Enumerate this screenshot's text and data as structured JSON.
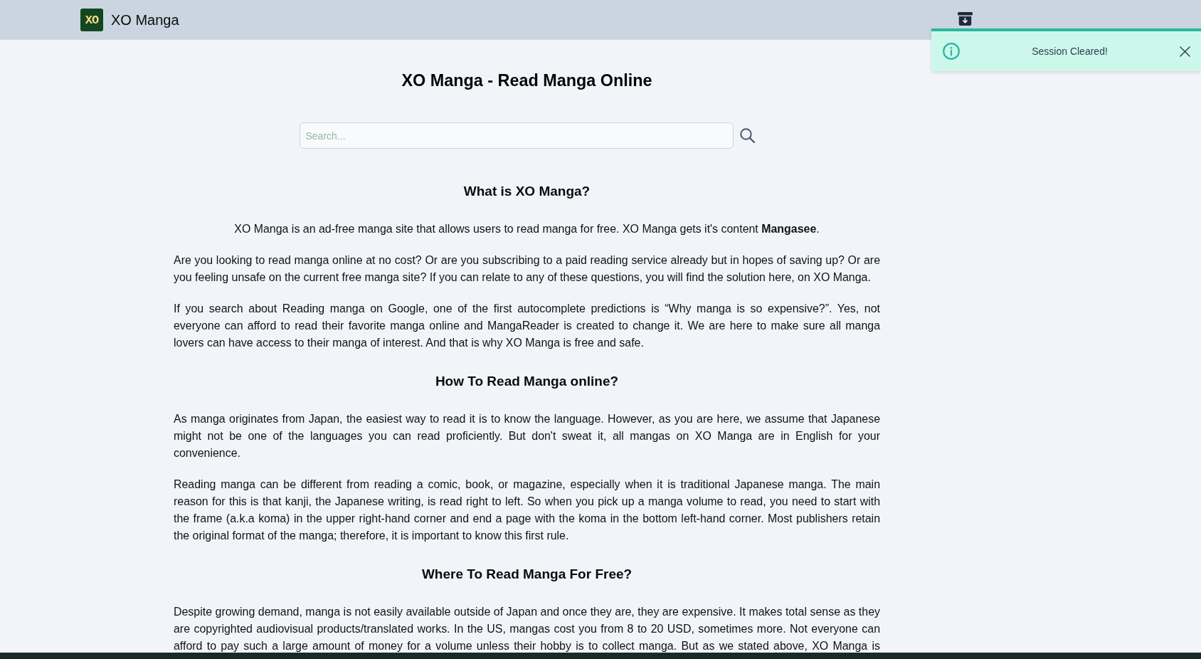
{
  "header": {
    "logo_text": "XO",
    "site_name": "XO Manga"
  },
  "toast": {
    "kind": "info",
    "message": "Session Cleared!"
  },
  "page_title": "XO Manga - Read Manga Online",
  "search": {
    "placeholder": "Search..."
  },
  "sections": [
    {
      "heading": "What is XO Manga?",
      "paragraphs": [
        {
          "kind": "lead",
          "text": "XO Manga is an ad-free manga site that allows users to read manga for free. XO Manga gets it's content **Mangasee**."
        },
        {
          "kind": "body",
          "text": "Are you looking to read manga online at no cost? Or are you subscribing to a paid reading service already but in hopes of saving up? Or are you feeling unsafe on the current free manga site? If you can relate to any of these questions, you will find the solution here, on XO Manga."
        },
        {
          "kind": "body",
          "text": "If you search about Reading manga on Google, one of the first autocomplete predictions is “Why manga is so expensive?”. Yes, not everyone can afford to read their favorite manga online and MangaReader is created to change it. We are here to make sure all manga lovers can have access to their manga of interest. And that is why XO Manga is free and safe."
        }
      ]
    },
    {
      "heading": "How To Read Manga online?",
      "paragraphs": [
        {
          "kind": "body",
          "text": "As manga originates from Japan, the easiest way to read it is to know the language. However, as you are here, we assume that Japanese might not be one of the languages you can read proficiently. But don't sweat it, all mangas on XO Manga are in English for your convenience."
        },
        {
          "kind": "body",
          "text": "Reading manga can be different from reading a comic, book, or magazine, especially when it is traditional Japanese manga. The main reason for this is that kanji, the Japanese writing, is read right to left. So when you pick up a manga volume to read, you need to start with the frame (a.k.a koma) in the upper right-hand corner and end a page with the koma in the bottom left-hand corner. Most publishers retain the original format of the manga; therefore, it is important to know this first rule."
        }
      ]
    },
    {
      "heading": "Where To Read Manga For Free?",
      "paragraphs": [
        {
          "kind": "body",
          "text": "Despite growing demand, manga is not easily available outside of Japan and once they are, they are expensive. It makes total sense as they are copyrighted audiovisual products/translated works. In the US, mangas cost you from 8 to 20 USD, sometimes more. Not everyone can afford to pay such a large amount of money for a volume unless their hobby is to collect manga. But as we stated above, XO Manga is"
        }
      ]
    }
  ]
}
